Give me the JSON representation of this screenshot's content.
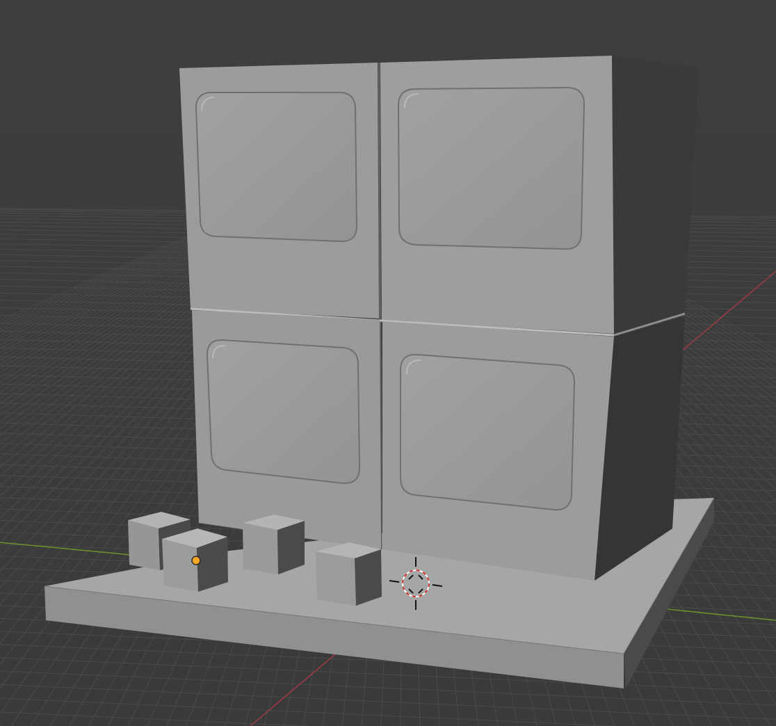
{
  "viewport": {
    "background_color": "#3d3d3d",
    "grid_color": "#4a4a4a",
    "x_axis_color": "#9a3a44",
    "y_axis_color": "#6e8f2c"
  },
  "scene": {
    "objects": [
      "ground-plane",
      "panel-block-top-left",
      "panel-block-top-right",
      "panel-block-bottom-left",
      "panel-block-bottom-right",
      "small-cube-1",
      "small-cube-2",
      "small-cube-3",
      "small-cube-4"
    ],
    "surface_color": "#9a9b9b",
    "shadow_side_color": "#3a393a",
    "origin_dot_color": "#f5a623",
    "cursor_icon": "3d-cursor-icon"
  }
}
